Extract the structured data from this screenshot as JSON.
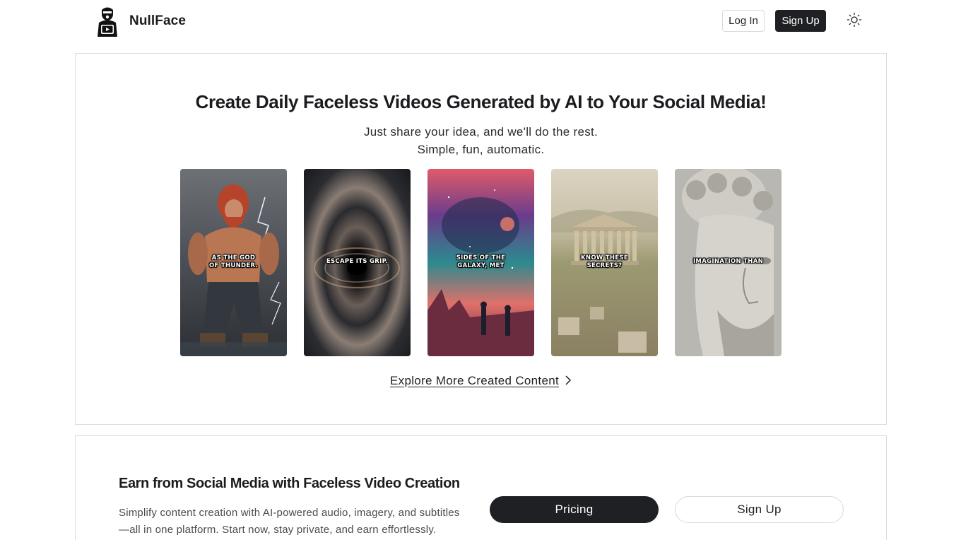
{
  "header": {
    "brand": "NullFace",
    "login_label": "Log In",
    "signup_label": "Sign Up",
    "theme_icon": "sun-icon"
  },
  "hero": {
    "title": "Create Daily Faceless Videos Generated by AI to Your Social Media!",
    "subtitle_line1": "Just share your idea, and we'll do the rest.",
    "subtitle_line2": "Simple, fun, automatic.",
    "videos": [
      {
        "caption_line1": "AS THE GOD",
        "caption_line2": "OF THUNDER."
      },
      {
        "caption_line1": "ESCAPE ITS GRIP.",
        "caption_line2": ""
      },
      {
        "caption_line1": "SIDES OF THE",
        "caption_line2": "GALAXY, MET"
      },
      {
        "caption_line1": "KNOW THESE",
        "caption_line2": "SECRETS?"
      },
      {
        "caption_line1": "IMAGINATION THAN",
        "caption_line2": ""
      }
    ],
    "explore_label": "Explore More Created Content"
  },
  "earn": {
    "title": "Earn from Social Media with Faceless Video Creation",
    "description": "Simplify content creation with AI-powered audio, imagery, and subtitles —all in one platform. Start now, stay private, and earn effortlessly.",
    "pricing_label": "Pricing",
    "signup_label": "Sign Up"
  },
  "colors": {
    "primary_dark": "#1f2023",
    "border": "#dcdcdc",
    "background": "#ffffff"
  }
}
